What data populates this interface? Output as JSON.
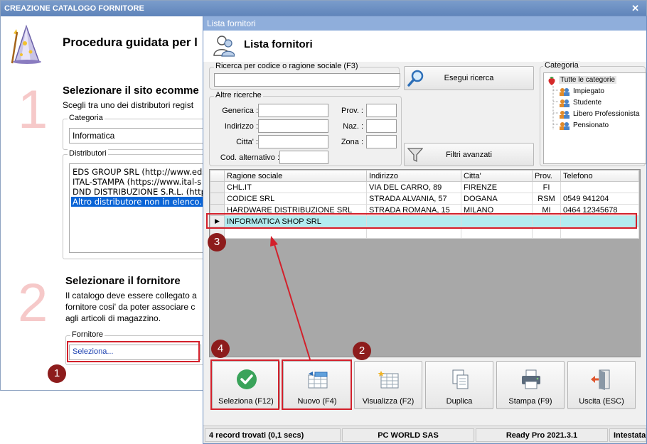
{
  "wizard": {
    "title": "CREAZIONE CATALOGO FORNITORE",
    "close_glyph": "✕",
    "heading": "Procedura guidata per l",
    "step1": {
      "number": "1",
      "title": "Selezionare il sito ecomme",
      "description": "Scegli tra uno dei distributori regist",
      "categoria_label": "Categoria",
      "categoria_value": "Informatica",
      "distributori_label": "Distributori",
      "distributori": [
        "EDS GROUP SRL (http://www.eds",
        "ITAL-STAMPA (https://www.ital-s",
        "DND DISTRIBUZIONE S.R.L. (http",
        "Altro distributore non in elenco..."
      ]
    },
    "step2": {
      "number": "2",
      "title": "Selezionare il fornitore",
      "lines": [
        "Il catalogo deve essere collegato a",
        "fornitore cosi' da poter associare c",
        "agli articoli di magazzino."
      ],
      "fornitore_label": "Fornitore",
      "fornitore_value": "Seleziona..."
    }
  },
  "dialog": {
    "title": "Lista fornitori",
    "header_title": "Lista fornitori",
    "search": {
      "group_label": "Ricerca per codice o ragione sociale (F3)",
      "value": "",
      "button_label": "Esegui ricerca"
    },
    "altre": {
      "group_label": "Altre ricerche",
      "generica": "Generica :",
      "indirizzo": "Indirizzo :",
      "citta": "Citta' :",
      "cod_alt": "Cod. alternativo :",
      "prov": "Prov. :",
      "naz": "Naz. :",
      "zona": "Zona :"
    },
    "filtri_label": "Filtri avanzati",
    "categoria": {
      "group_label": "Categoria",
      "root": "Tutte le categorie",
      "children": [
        "Impiegato",
        "Studente",
        "Libero Professionista",
        "Pensionato"
      ]
    },
    "grid": {
      "columns": [
        "Ragione sociale",
        "Indirizzo",
        "Citta'",
        "Prov.",
        "Telefono"
      ],
      "rows": [
        {
          "ragione": "CHL.IT",
          "indirizzo": "VIA DEL CARRO, 89",
          "citta": "FIRENZE",
          "prov": "FI",
          "telefono": ""
        },
        {
          "ragione": "CODICE SRL",
          "indirizzo": "STRADA ALVANIA, 57",
          "citta": "DOGANA",
          "prov": "RSM",
          "telefono": "0549 941204"
        },
        {
          "ragione": "HARDWARE DISTRIBUZIONE SRL",
          "indirizzo": "STRADA ROMANA, 15",
          "citta": "MILANO",
          "prov": "MI",
          "telefono": "0464 12345678"
        },
        {
          "ragione": "INFORMATICA SHOP SRL",
          "indirizzo": "",
          "citta": "",
          "prov": "",
          "telefono": ""
        }
      ],
      "current_row_marker": "▶"
    },
    "buttons": {
      "seleziona": "Seleziona (F12)",
      "nuovo": "Nuovo (F4)",
      "visualizza": "Visualizza (F2)",
      "duplica": "Duplica",
      "stampa": "Stampa (F9)",
      "uscita": "Uscita (ESC)"
    },
    "status": {
      "records": "4 record trovati (0,1 secs)",
      "company": "PC WORLD SAS",
      "version": "Ready Pro 2021.3.1",
      "intestatario": "Intestata"
    }
  },
  "annotations": [
    "1",
    "2",
    "3",
    "4"
  ],
  "colors": {
    "annotation_red": "#d3202b",
    "badge_red": "#8d1c1c",
    "highlight_row": "#b3ecf0",
    "selection_blue": "#0a64d6",
    "step_number": "#f6c9c9",
    "select_green": "#3aa35a"
  }
}
